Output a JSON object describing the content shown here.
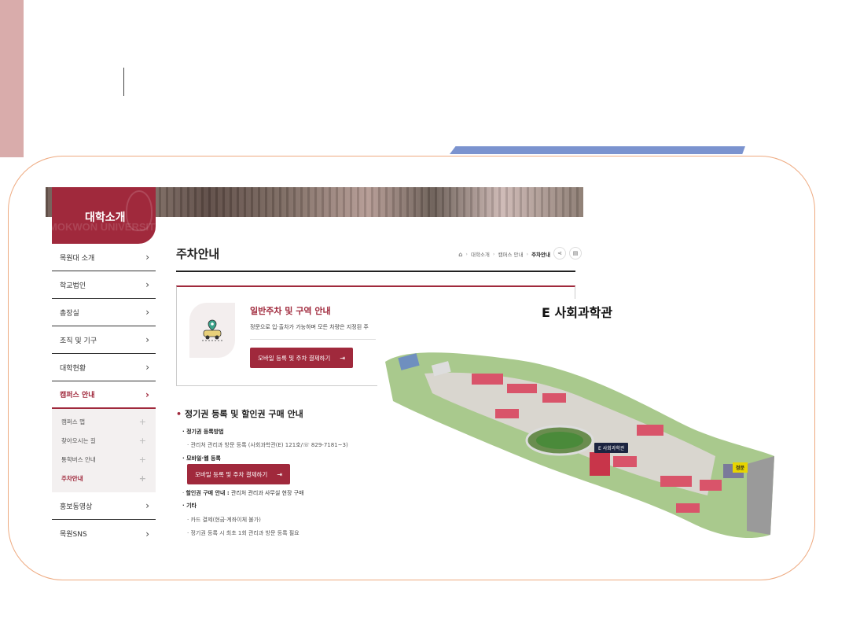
{
  "sidebar_header": {
    "title": "대학소개",
    "watermark": "MOKWON UNIVERSITY"
  },
  "sidebar": {
    "items": [
      {
        "label": "목원대 소개"
      },
      {
        "label": "학교법인"
      },
      {
        "label": "총장실"
      },
      {
        "label": "조직 및 기구"
      },
      {
        "label": "대학현황"
      },
      {
        "label": "캠퍼스 안내"
      }
    ],
    "sub_items": [
      {
        "label": "캠퍼스 맵"
      },
      {
        "label": "찾아오시는 길"
      },
      {
        "label": "통학버스 안내"
      },
      {
        "label": "주차안내"
      }
    ],
    "items_after": [
      {
        "label": "홍보동영상"
      },
      {
        "label": "목원SNS"
      }
    ]
  },
  "page": {
    "title": "주차안내",
    "breadcrumb": [
      "대학소개",
      "캠퍼스 안내",
      "주차안내"
    ]
  },
  "card": {
    "title": "일반주차 및 구역 안내",
    "desc": "정문으로 입·출차가 가능하며 모든 차량은 지정된 주",
    "button": "모바일 등록 및 주차 결제하기",
    "button_arrow": "⇥"
  },
  "section": {
    "title": "정기권 등록 및 할인권 구매 안내",
    "h1": "정기권 등록방법",
    "h1_text": "관리처 관리과 방문 등록 (사회과학관(E) 121호/☏ 829-7181~3)",
    "h2": "모바일·웹 등록",
    "button": "모바일 등록 및 주차 결제하기",
    "button_arrow": "⇥",
    "h3": "할인권 구매 안내 :",
    "h3_text": "관리처 관리과 사무실 현장 구매",
    "h4": "기타",
    "h4_item1": "카드 결제(현금·계좌이체 불가)",
    "h4_item2": "정기권 등록 시 최초 1회 관리과 방문 등록 필요"
  },
  "map": {
    "title": "E 사회과학관",
    "building_label": "E   사회과학관",
    "gate_label": "정문"
  },
  "colors": {
    "brand": "#a0293c",
    "accent_bar": "#7b93cf",
    "frame": "#eeaa80",
    "left_bar": "#d9acab"
  }
}
